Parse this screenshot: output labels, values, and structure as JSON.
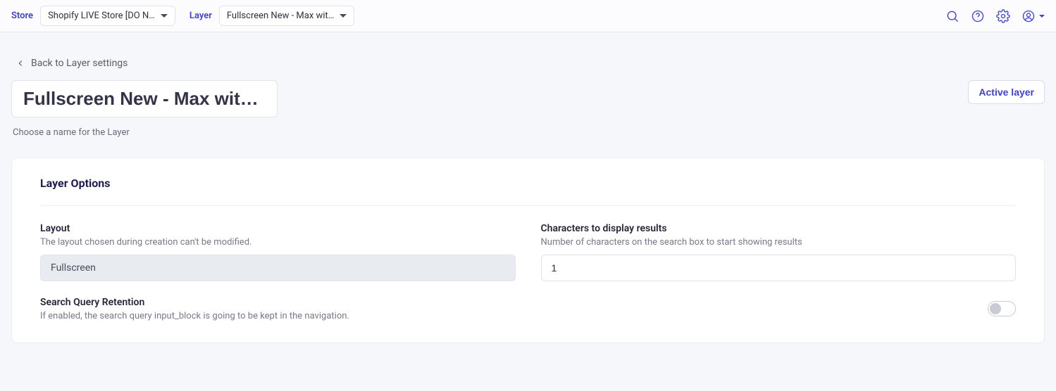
{
  "topbar": {
    "store_label": "Store",
    "store_value": "Shopify LIVE Store [DO N…",
    "layer_label": "Layer",
    "layer_value": "Fullscreen New - Max wit…"
  },
  "back_link": "Back to Layer settings",
  "title_value": "Fullscreen New - Max without",
  "title_helper": "Choose a name for the Layer",
  "status_button": "Active layer",
  "card": {
    "title": "Layer Options",
    "layout": {
      "label": "Layout",
      "desc": "The layout chosen during creation can't be modified.",
      "value": "Fullscreen"
    },
    "chars": {
      "label": "Characters to display results",
      "desc": "Number of characters on the search box to start showing results",
      "value": "1"
    },
    "retention": {
      "label": "Search Query Retention",
      "desc": "If enabled, the search query input_block is going to be kept in the navigation."
    }
  }
}
